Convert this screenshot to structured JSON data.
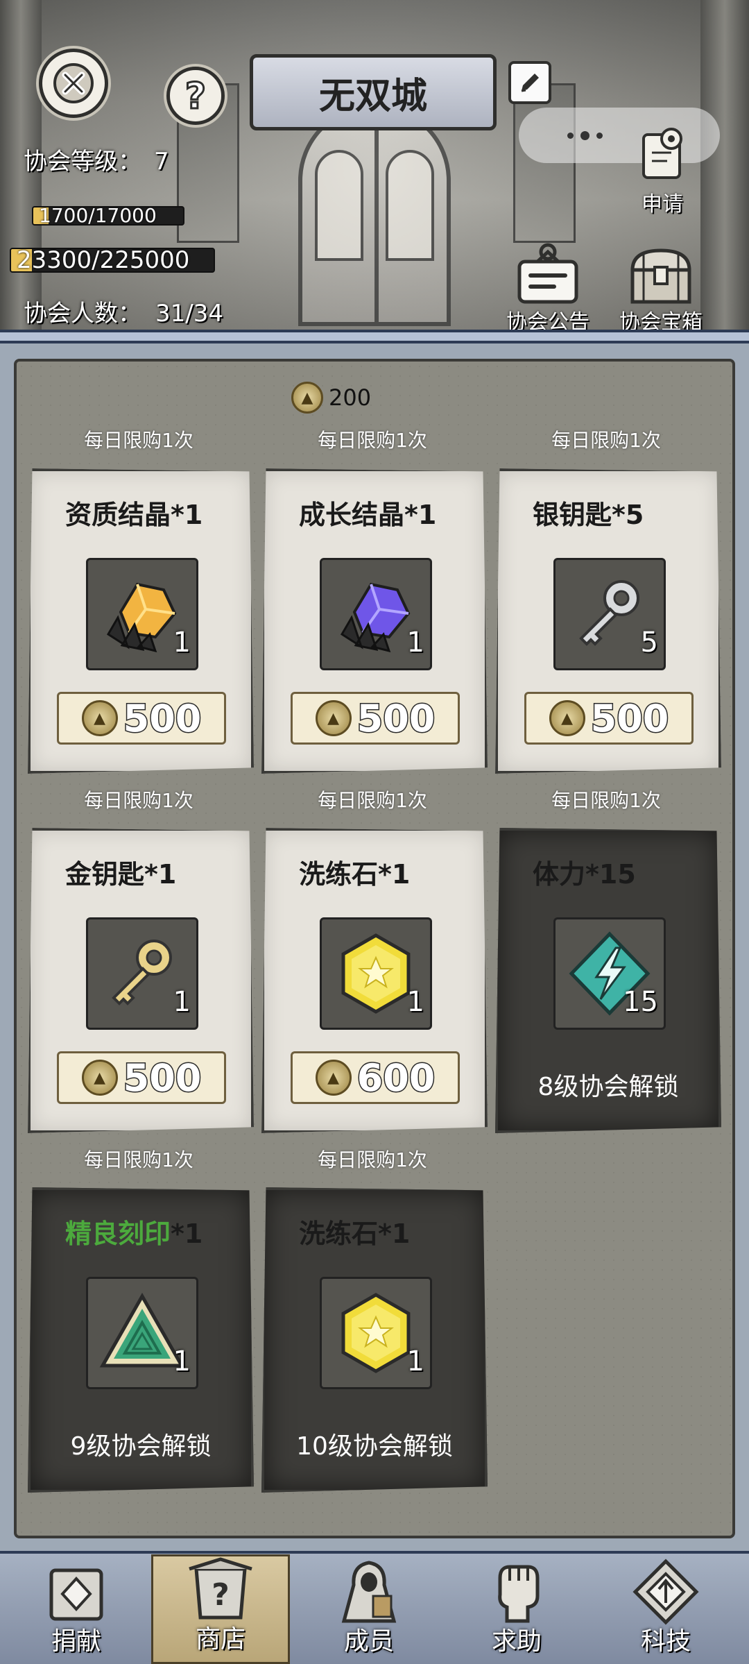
{
  "header": {
    "guild_name": "无双城",
    "level_label": "协会等级：",
    "level_value": "7",
    "exp_bar": {
      "text": "1700/17000",
      "fraction": 0.1
    },
    "fund_bar": {
      "text": "23300/225000",
      "fraction": 0.1036
    },
    "members_label": "协会人数：",
    "members_value": "31/34",
    "apply_label": "申请",
    "notice_label": "协会公告",
    "chest_label": "协会宝箱"
  },
  "shop": {
    "currency_amount": "200",
    "rows": [
      {
        "limit_labels": [
          "每日限购1次",
          "每日限购1次",
          "每日限购1次"
        ]
      },
      {
        "limit_labels": [
          "每日限购1次",
          "每日限购1次",
          "每日限购1次"
        ]
      },
      {
        "limit_labels": [
          "每日限购1次",
          "每日限购1次"
        ]
      }
    ],
    "items": [
      {
        "title": "资质结晶*1",
        "count": "1",
        "price": "500",
        "icon": "orange-crystal-icon"
      },
      {
        "title": "成长结晶*1",
        "count": "1",
        "price": "500",
        "icon": "purple-crystal-icon"
      },
      {
        "title": "银钥匙*5",
        "count": "5",
        "price": "500",
        "icon": "silver-key-icon"
      },
      {
        "title": "金钥匙*1",
        "count": "1",
        "price": "500",
        "icon": "gold-key-icon"
      },
      {
        "title": "洗练石*1",
        "count": "1",
        "price": "600",
        "icon": "refining-stone-icon"
      },
      {
        "title": "体力*15",
        "count": "15",
        "unlock": "8级协会解锁",
        "icon": "stamina-icon",
        "locked": true
      },
      {
        "title_colored": "精良刻印",
        "title_suffix": "*1",
        "count": "1",
        "unlock": "9级协会解锁",
        "icon": "fine-seal-icon",
        "locked": true,
        "title_color": "#4caa3d"
      },
      {
        "title": "洗练石*1",
        "count": "1",
        "unlock": "10级协会解锁",
        "icon": "refining-stone-icon",
        "locked": true
      }
    ]
  },
  "tabs": [
    {
      "label": "捐献",
      "icon": "donate-icon"
    },
    {
      "label": "商店",
      "icon": "shop-icon",
      "active": true
    },
    {
      "label": "成员",
      "icon": "members-icon"
    },
    {
      "label": "求助",
      "icon": "help-fist-icon"
    },
    {
      "label": "科技",
      "icon": "tech-icon"
    }
  ]
}
